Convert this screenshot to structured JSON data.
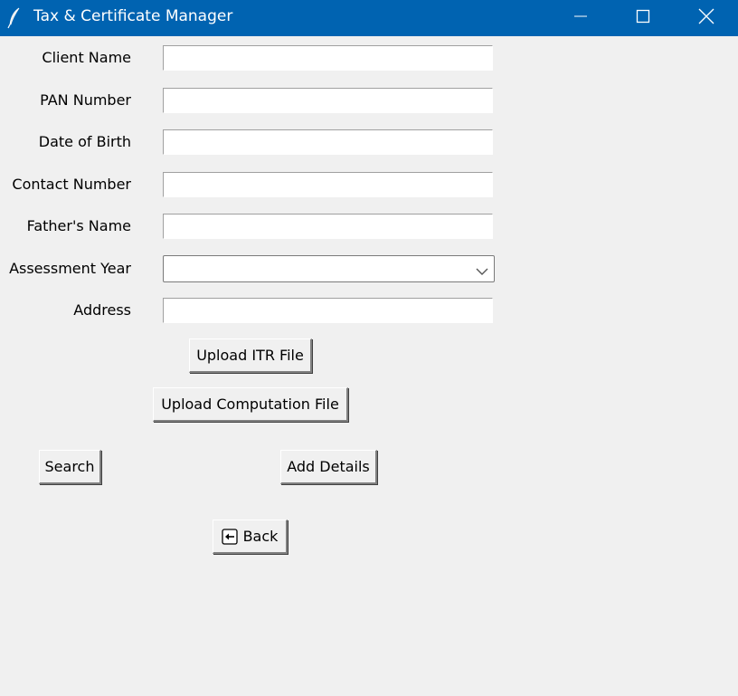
{
  "window": {
    "title": "Tax & Certificate Manager",
    "accent": "#0063b1"
  },
  "form": {
    "labels": {
      "client_name": "Client Name",
      "pan_number": "PAN Number",
      "dob": "Date of Birth",
      "contact": "Contact Number",
      "father_name": "Father's Name",
      "assessment_year": "Assessment Year",
      "address": "Address"
    },
    "values": {
      "client_name": "",
      "pan_number": "",
      "dob": "",
      "contact": "",
      "father_name": "",
      "assessment_year": "",
      "address": ""
    }
  },
  "buttons": {
    "upload_itr": "Upload ITR File",
    "upload_computation": "Upload Computation File",
    "search": "Search",
    "add_details": "Add Details",
    "back": "Back"
  },
  "icons": {
    "app": "feather-icon",
    "minimize": "minimize-icon",
    "maximize": "maximize-icon",
    "close": "close-icon",
    "dropdown": "chevron-down-icon",
    "back": "back-arrow-icon"
  }
}
